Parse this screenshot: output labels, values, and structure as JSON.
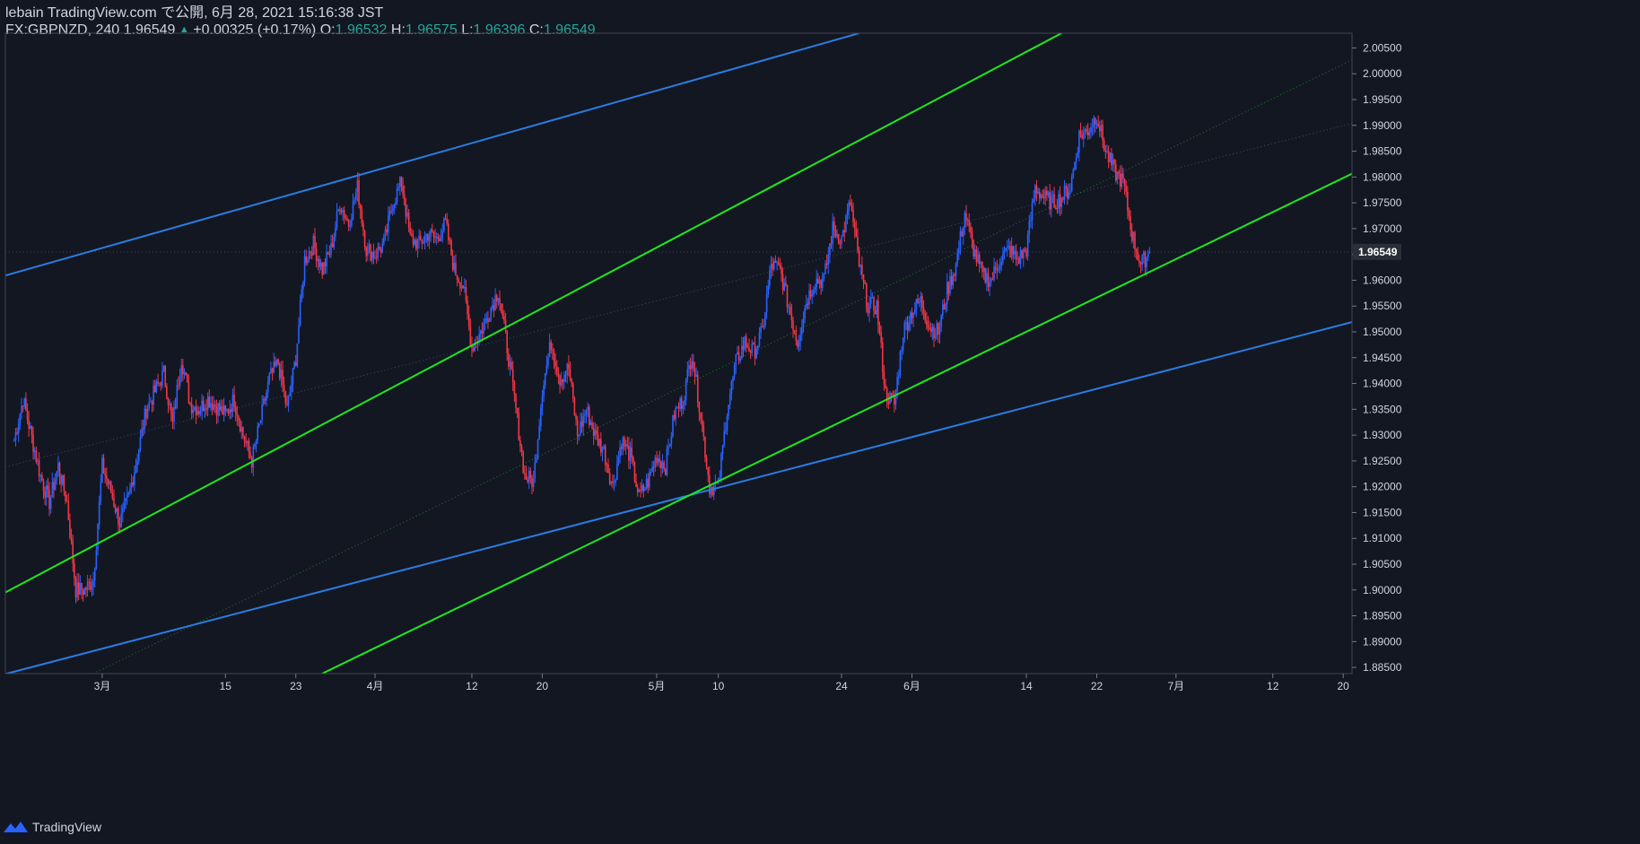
{
  "header": {
    "line1": "lebain TradingView.com で公開, 6月 28, 2021 15:16:38 JST",
    "symbol": "FX:GBPNZD, 240",
    "last": "1.96549",
    "change": "+0.00325 (+0.17%)",
    "o_label": "O:",
    "o_value": "1.96532",
    "h_label": "H:",
    "h_value": "1.96575",
    "l_label": "L:",
    "l_value": "1.96396",
    "c_label": "C:",
    "c_value": "1.96549"
  },
  "footer": {
    "brand": "TradingView"
  },
  "colors": {
    "background": "#131722",
    "up": "#2962ff",
    "down": "#f23645",
    "blue_line": "#2a7de1",
    "green_line": "#1ee81e",
    "text": "#d1d4dc",
    "price_label_bg": "#2a2e39"
  },
  "chart_data": {
    "type": "candlestick",
    "symbol": "FX:GBPNZD",
    "interval": "240",
    "y_ticks": [
      2.005,
      2.0,
      1.995,
      1.99,
      1.985,
      1.98,
      1.975,
      1.97,
      1.965,
      1.96,
      1.955,
      1.95,
      1.945,
      1.94,
      1.935,
      1.93,
      1.925,
      1.92,
      1.915,
      1.91,
      1.905,
      1.9,
      1.895,
      1.89,
      1.885
    ],
    "y_tick_labels": [
      "2.00500",
      "2.00000",
      "1.99500",
      "1.99000",
      "1.98500",
      "1.98000",
      "1.97500",
      "1.97000",
      "1.96500",
      "1.96000",
      "1.95500",
      "1.95000",
      "1.94500",
      "1.94000",
      "1.93500",
      "1.93000",
      "1.92500",
      "1.92000",
      "1.91500",
      "1.91000",
      "1.90500",
      "1.90000",
      "1.89500",
      "1.89000",
      "1.88500"
    ],
    "ylim": [
      1.8838,
      2.00786
    ],
    "last_price": 1.96549,
    "last_price_label": "1.96549",
    "x_ticks": [
      {
        "date": "2021-03-01",
        "label": "3月"
      },
      {
        "date": "2021-03-15",
        "label": "15"
      },
      {
        "date": "2021-03-23",
        "label": "23"
      },
      {
        "date": "2021-04-01",
        "label": "4月"
      },
      {
        "date": "2021-04-12",
        "label": "12"
      },
      {
        "date": "2021-04-20",
        "label": "20"
      },
      {
        "date": "2021-05-03",
        "label": "5月"
      },
      {
        "date": "2021-05-10",
        "label": "10"
      },
      {
        "date": "2021-05-24",
        "label": "24"
      },
      {
        "date": "2021-06-01",
        "label": "6月"
      },
      {
        "date": "2021-06-14",
        "label": "14"
      },
      {
        "date": "2021-06-22",
        "label": "22"
      },
      {
        "date": "2021-07-01",
        "label": "7月"
      },
      {
        "date": "2021-07-12",
        "label": "12"
      },
      {
        "date": "2021-07-20",
        "label": "20"
      }
    ],
    "path_points": [
      {
        "date": "2021-02-19",
        "close": 1.929
      },
      {
        "date": "2021-02-20",
        "close": 1.937
      },
      {
        "date": "2021-02-22",
        "close": 1.922
      },
      {
        "date": "2021-02-23",
        "close": 1.917
      },
      {
        "date": "2021-02-24",
        "close": 1.924
      },
      {
        "date": "2021-02-25",
        "close": 1.917
      },
      {
        "date": "2021-02-26",
        "close": 1.9
      },
      {
        "date": "2021-02-27",
        "close": 1.9
      },
      {
        "date": "2021-02-28",
        "close": 1.902
      },
      {
        "date": "2021-03-01",
        "close": 1.924
      },
      {
        "date": "2021-03-02",
        "close": 1.919
      },
      {
        "date": "2021-03-03",
        "close": 1.913
      },
      {
        "date": "2021-03-04",
        "close": 1.918
      },
      {
        "date": "2021-03-05",
        "close": 1.926
      },
      {
        "date": "2021-03-06",
        "close": 1.935
      },
      {
        "date": "2021-03-08",
        "close": 1.942
      },
      {
        "date": "2021-03-09",
        "close": 1.932
      },
      {
        "date": "2021-03-10",
        "close": 1.945
      },
      {
        "date": "2021-03-11",
        "close": 1.936
      },
      {
        "date": "2021-03-12",
        "close": 1.935
      },
      {
        "date": "2021-03-13",
        "close": 1.937
      },
      {
        "date": "2021-03-15",
        "close": 1.934
      },
      {
        "date": "2021-03-16",
        "close": 1.937
      },
      {
        "date": "2021-03-17",
        "close": 1.93
      },
      {
        "date": "2021-03-18",
        "close": 1.925
      },
      {
        "date": "2021-03-19",
        "close": 1.933
      },
      {
        "date": "2021-03-20",
        "close": 1.941
      },
      {
        "date": "2021-03-21",
        "close": 1.944
      },
      {
        "date": "2021-03-22",
        "close": 1.935
      },
      {
        "date": "2021-03-23",
        "close": 1.945
      },
      {
        "date": "2021-03-24",
        "close": 1.964
      },
      {
        "date": "2021-03-25",
        "close": 1.967
      },
      {
        "date": "2021-03-26",
        "close": 1.962
      },
      {
        "date": "2021-03-27",
        "close": 1.966
      },
      {
        "date": "2021-03-28",
        "close": 1.975
      },
      {
        "date": "2021-03-29",
        "close": 1.971
      },
      {
        "date": "2021-03-30",
        "close": 1.978
      },
      {
        "date": "2021-03-31",
        "close": 1.966
      },
      {
        "date": "2021-04-01",
        "close": 1.965
      },
      {
        "date": "2021-04-02",
        "close": 1.967
      },
      {
        "date": "2021-04-03",
        "close": 1.975
      },
      {
        "date": "2021-04-04",
        "close": 1.979
      },
      {
        "date": "2021-04-05",
        "close": 1.968
      },
      {
        "date": "2021-04-06",
        "close": 1.967
      },
      {
        "date": "2021-04-07",
        "close": 1.969
      },
      {
        "date": "2021-04-08",
        "close": 1.968
      },
      {
        "date": "2021-04-09",
        "close": 1.971
      },
      {
        "date": "2021-04-10",
        "close": 1.962
      },
      {
        "date": "2021-04-11",
        "close": 1.959
      },
      {
        "date": "2021-04-12",
        "close": 1.947
      },
      {
        "date": "2021-04-13",
        "close": 1.95
      },
      {
        "date": "2021-04-14",
        "close": 1.954
      },
      {
        "date": "2021-04-15",
        "close": 1.958
      },
      {
        "date": "2021-04-16",
        "close": 1.947
      },
      {
        "date": "2021-04-17",
        "close": 1.935
      },
      {
        "date": "2021-04-18",
        "close": 1.922
      },
      {
        "date": "2021-04-19",
        "close": 1.921
      },
      {
        "date": "2021-04-20",
        "close": 1.939
      },
      {
        "date": "2021-04-21",
        "close": 1.948
      },
      {
        "date": "2021-04-22",
        "close": 1.941
      },
      {
        "date": "2021-04-23",
        "close": 1.943
      },
      {
        "date": "2021-04-24",
        "close": 1.93
      },
      {
        "date": "2021-04-25",
        "close": 1.935
      },
      {
        "date": "2021-04-26",
        "close": 1.93
      },
      {
        "date": "2021-04-27",
        "close": 1.927
      },
      {
        "date": "2021-04-28",
        "close": 1.92
      },
      {
        "date": "2021-04-29",
        "close": 1.929
      },
      {
        "date": "2021-04-30",
        "close": 1.926
      },
      {
        "date": "2021-05-01",
        "close": 1.918
      },
      {
        "date": "2021-05-02",
        "close": 1.921
      },
      {
        "date": "2021-05-03",
        "close": 1.926
      },
      {
        "date": "2021-05-04",
        "close": 1.924
      },
      {
        "date": "2021-05-05",
        "close": 1.934
      },
      {
        "date": "2021-05-06",
        "close": 1.937
      },
      {
        "date": "2021-05-07",
        "close": 1.946
      },
      {
        "date": "2021-05-08",
        "close": 1.934
      },
      {
        "date": "2021-05-09",
        "close": 1.92
      },
      {
        "date": "2021-05-10",
        "close": 1.92
      },
      {
        "date": "2021-05-11",
        "close": 1.935
      },
      {
        "date": "2021-05-12",
        "close": 1.944
      },
      {
        "date": "2021-05-13",
        "close": 1.948
      },
      {
        "date": "2021-05-14",
        "close": 1.946
      },
      {
        "date": "2021-05-15",
        "close": 1.95
      },
      {
        "date": "2021-05-16",
        "close": 1.963
      },
      {
        "date": "2021-05-17",
        "close": 1.962
      },
      {
        "date": "2021-05-18",
        "close": 1.955
      },
      {
        "date": "2021-05-19",
        "close": 1.948
      },
      {
        "date": "2021-05-20",
        "close": 1.956
      },
      {
        "date": "2021-05-21",
        "close": 1.96
      },
      {
        "date": "2021-05-22",
        "close": 1.96
      },
      {
        "date": "2021-05-23",
        "close": 1.97
      },
      {
        "date": "2021-05-24",
        "close": 1.968
      },
      {
        "date": "2021-05-25",
        "close": 1.975
      },
      {
        "date": "2021-05-26",
        "close": 1.963
      },
      {
        "date": "2021-05-27",
        "close": 1.955
      },
      {
        "date": "2021-05-28",
        "close": 1.955
      },
      {
        "date": "2021-05-29",
        "close": 1.938
      },
      {
        "date": "2021-05-30",
        "close": 1.936
      },
      {
        "date": "2021-05-31",
        "close": 1.95
      },
      {
        "date": "2021-06-01",
        "close": 1.954
      },
      {
        "date": "2021-06-02",
        "close": 1.956
      },
      {
        "date": "2021-06-03",
        "close": 1.951
      },
      {
        "date": "2021-06-04",
        "close": 1.95
      },
      {
        "date": "2021-06-05",
        "close": 1.958
      },
      {
        "date": "2021-06-06",
        "close": 1.963
      },
      {
        "date": "2021-06-07",
        "close": 1.973
      },
      {
        "date": "2021-06-08",
        "close": 1.966
      },
      {
        "date": "2021-06-09",
        "close": 1.961
      },
      {
        "date": "2021-06-10",
        "close": 1.96
      },
      {
        "date": "2021-06-11",
        "close": 1.964
      },
      {
        "date": "2021-06-12",
        "close": 1.966
      },
      {
        "date": "2021-06-13",
        "close": 1.964
      },
      {
        "date": "2021-06-14",
        "close": 1.966
      },
      {
        "date": "2021-06-15",
        "close": 1.978
      },
      {
        "date": "2021-06-16",
        "close": 1.976
      },
      {
        "date": "2021-06-17",
        "close": 1.975
      },
      {
        "date": "2021-06-18",
        "close": 1.976
      },
      {
        "date": "2021-06-19",
        "close": 1.978
      },
      {
        "date": "2021-06-20",
        "close": 1.988
      },
      {
        "date": "2021-06-21",
        "close": 1.989
      },
      {
        "date": "2021-06-22",
        "close": 1.992
      },
      {
        "date": "2021-06-23",
        "close": 1.985
      },
      {
        "date": "2021-06-24",
        "close": 1.981
      },
      {
        "date": "2021-06-25",
        "close": 1.979
      },
      {
        "date": "2021-06-26",
        "close": 1.969
      },
      {
        "date": "2021-06-27",
        "close": 1.963
      },
      {
        "date": "2021-06-28",
        "close": 1.9655
      }
    ],
    "trend_lines": [
      {
        "name": "upper blue channel",
        "color": "#2a7de1",
        "p1": {
          "date": "2021-02-18",
          "y": 1.96092
        },
        "p2": {
          "date": "2021-05-26",
          "y": 2.00786
        }
      },
      {
        "name": "lower blue channel",
        "color": "#2a7de1",
        "p1": {
          "date": "2021-02-18",
          "y": 1.88372
        },
        "p2": {
          "date": "2021-07-21",
          "y": 1.95189
        }
      },
      {
        "name": "upper green channel",
        "color": "#1ee81e",
        "p1": {
          "date": "2021-02-18",
          "y": 1.89953
        },
        "p2": {
          "date": "2021-06-18",
          "y": 2.00786
        }
      },
      {
        "name": "lower green channel",
        "color": "#1ee81e",
        "p1": {
          "date": "2021-03-26",
          "y": 1.8838
        },
        "p2": {
          "date": "2021-07-21",
          "y": 1.98065
        }
      }
    ],
    "dotted_lines": [
      {
        "color": "#3a4a66",
        "p1": {
          "date": "2021-02-18",
          "y": 1.92385
        },
        "p2": {
          "date": "2021-07-21",
          "y": 1.99037
        }
      },
      {
        "color": "#1f7a2a",
        "p1": {
          "date": "2021-02-28",
          "y": 1.8838
        },
        "p2": {
          "date": "2021-07-21",
          "y": 2.00267
        }
      }
    ]
  }
}
